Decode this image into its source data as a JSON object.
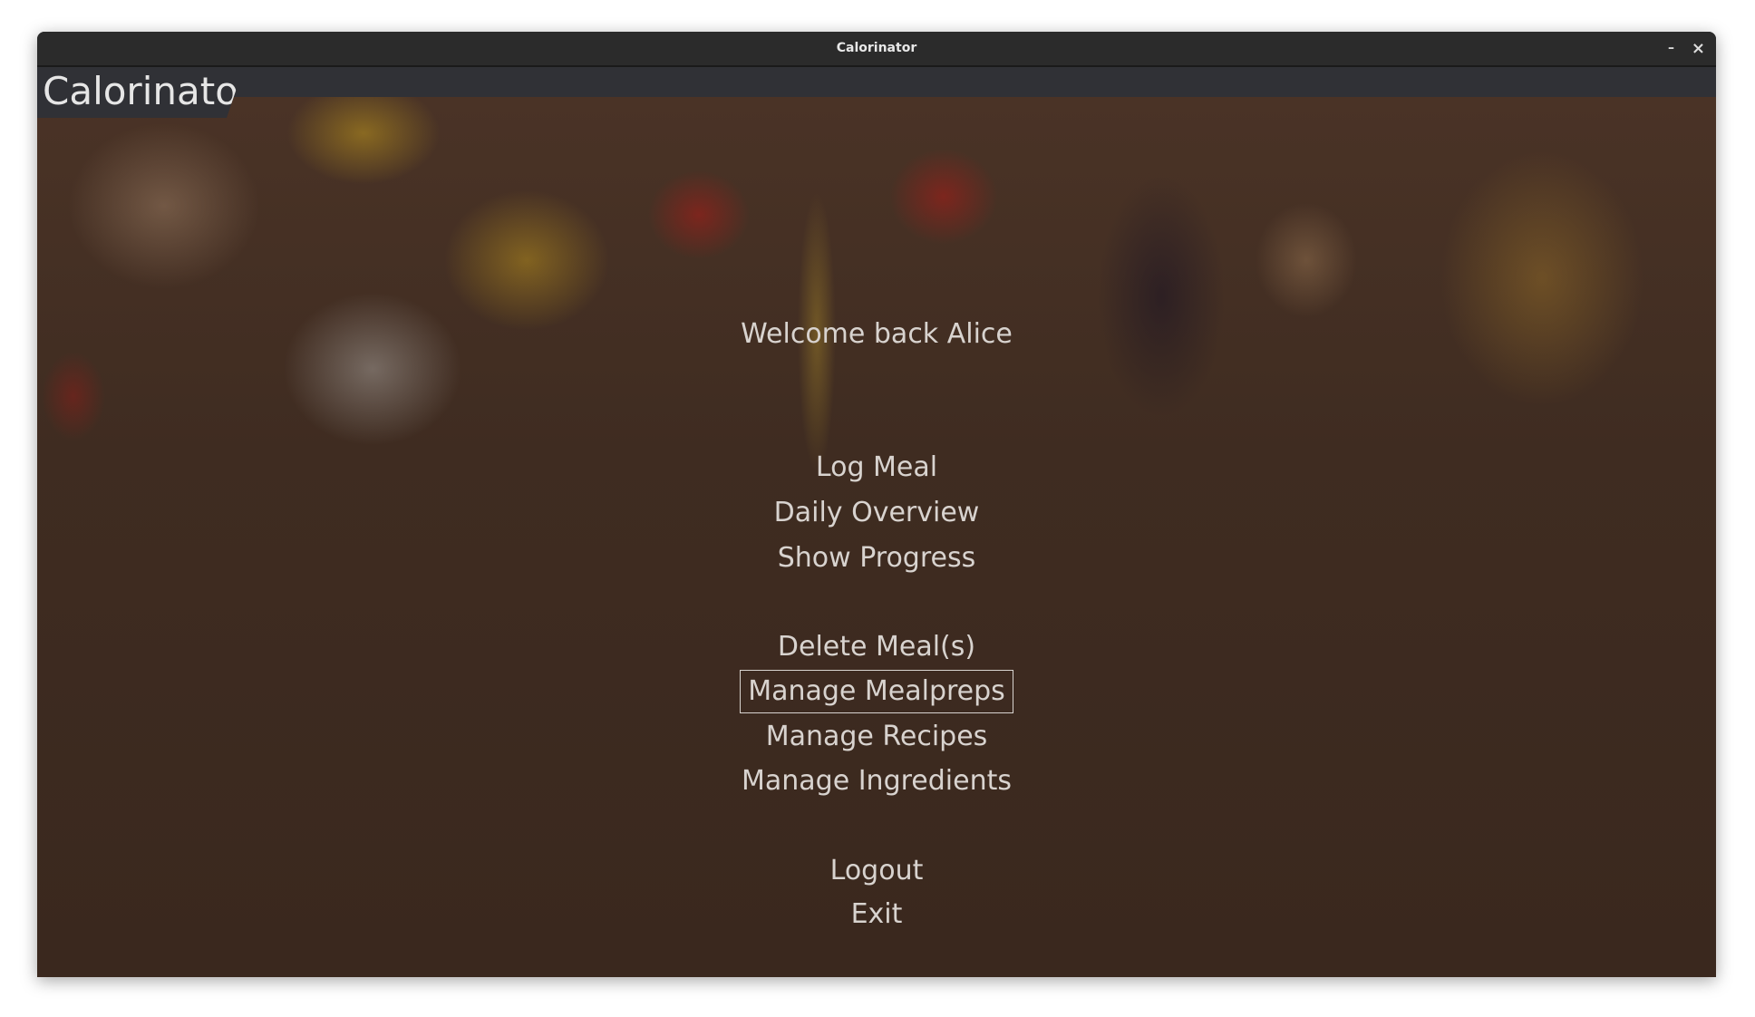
{
  "window": {
    "title": "Calorinator",
    "minimize_label": "–",
    "close_label": "×"
  },
  "app": {
    "logo": "Calorinator"
  },
  "main": {
    "welcome": "Welcome back Alice",
    "menu": [
      "Log Meal",
      "Daily Overview",
      "Show Progress",
      "Delete Meal(s)",
      "Manage Mealpreps",
      "Manage Recipes",
      "Manage Ingredients",
      "Logout",
      "Exit"
    ],
    "selected": "Manage Mealpreps"
  }
}
